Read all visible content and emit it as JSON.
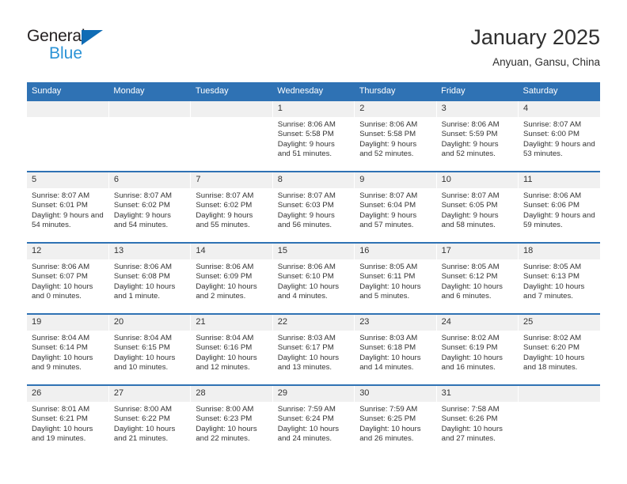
{
  "brand": {
    "name_part1": "General",
    "name_part2": "Blue",
    "triangle_icon": "blue-triangle-icon",
    "accent_color": "#0f6cb5",
    "secondary_color": "#2b93d6"
  },
  "header": {
    "title": "January 2025",
    "subtitle": "Anyuan, Gansu, China"
  },
  "calendar": {
    "header_bg": "#2f72b4",
    "daynum_bg": "#f0f0f0",
    "weekday_headers": [
      "Sunday",
      "Monday",
      "Tuesday",
      "Wednesday",
      "Thursday",
      "Friday",
      "Saturday"
    ],
    "weeks": [
      [
        {
          "day": "",
          "sunrise": "",
          "sunset": "",
          "daylight": "",
          "empty": true
        },
        {
          "day": "",
          "sunrise": "",
          "sunset": "",
          "daylight": "",
          "empty": true
        },
        {
          "day": "",
          "sunrise": "",
          "sunset": "",
          "daylight": "",
          "empty": true
        },
        {
          "day": "1",
          "sunrise": "Sunrise: 8:06 AM",
          "sunset": "Sunset: 5:58 PM",
          "daylight": "Daylight: 9 hours and 51 minutes."
        },
        {
          "day": "2",
          "sunrise": "Sunrise: 8:06 AM",
          "sunset": "Sunset: 5:58 PM",
          "daylight": "Daylight: 9 hours and 52 minutes."
        },
        {
          "day": "3",
          "sunrise": "Sunrise: 8:06 AM",
          "sunset": "Sunset: 5:59 PM",
          "daylight": "Daylight: 9 hours and 52 minutes."
        },
        {
          "day": "4",
          "sunrise": "Sunrise: 8:07 AM",
          "sunset": "Sunset: 6:00 PM",
          "daylight": "Daylight: 9 hours and 53 minutes."
        }
      ],
      [
        {
          "day": "5",
          "sunrise": "Sunrise: 8:07 AM",
          "sunset": "Sunset: 6:01 PM",
          "daylight": "Daylight: 9 hours and 54 minutes."
        },
        {
          "day": "6",
          "sunrise": "Sunrise: 8:07 AM",
          "sunset": "Sunset: 6:02 PM",
          "daylight": "Daylight: 9 hours and 54 minutes."
        },
        {
          "day": "7",
          "sunrise": "Sunrise: 8:07 AM",
          "sunset": "Sunset: 6:02 PM",
          "daylight": "Daylight: 9 hours and 55 minutes."
        },
        {
          "day": "8",
          "sunrise": "Sunrise: 8:07 AM",
          "sunset": "Sunset: 6:03 PM",
          "daylight": "Daylight: 9 hours and 56 minutes."
        },
        {
          "day": "9",
          "sunrise": "Sunrise: 8:07 AM",
          "sunset": "Sunset: 6:04 PM",
          "daylight": "Daylight: 9 hours and 57 minutes."
        },
        {
          "day": "10",
          "sunrise": "Sunrise: 8:07 AM",
          "sunset": "Sunset: 6:05 PM",
          "daylight": "Daylight: 9 hours and 58 minutes."
        },
        {
          "day": "11",
          "sunrise": "Sunrise: 8:06 AM",
          "sunset": "Sunset: 6:06 PM",
          "daylight": "Daylight: 9 hours and 59 minutes."
        }
      ],
      [
        {
          "day": "12",
          "sunrise": "Sunrise: 8:06 AM",
          "sunset": "Sunset: 6:07 PM",
          "daylight": "Daylight: 10 hours and 0 minutes."
        },
        {
          "day": "13",
          "sunrise": "Sunrise: 8:06 AM",
          "sunset": "Sunset: 6:08 PM",
          "daylight": "Daylight: 10 hours and 1 minute."
        },
        {
          "day": "14",
          "sunrise": "Sunrise: 8:06 AM",
          "sunset": "Sunset: 6:09 PM",
          "daylight": "Daylight: 10 hours and 2 minutes."
        },
        {
          "day": "15",
          "sunrise": "Sunrise: 8:06 AM",
          "sunset": "Sunset: 6:10 PM",
          "daylight": "Daylight: 10 hours and 4 minutes."
        },
        {
          "day": "16",
          "sunrise": "Sunrise: 8:05 AM",
          "sunset": "Sunset: 6:11 PM",
          "daylight": "Daylight: 10 hours and 5 minutes."
        },
        {
          "day": "17",
          "sunrise": "Sunrise: 8:05 AM",
          "sunset": "Sunset: 6:12 PM",
          "daylight": "Daylight: 10 hours and 6 minutes."
        },
        {
          "day": "18",
          "sunrise": "Sunrise: 8:05 AM",
          "sunset": "Sunset: 6:13 PM",
          "daylight": "Daylight: 10 hours and 7 minutes."
        }
      ],
      [
        {
          "day": "19",
          "sunrise": "Sunrise: 8:04 AM",
          "sunset": "Sunset: 6:14 PM",
          "daylight": "Daylight: 10 hours and 9 minutes."
        },
        {
          "day": "20",
          "sunrise": "Sunrise: 8:04 AM",
          "sunset": "Sunset: 6:15 PM",
          "daylight": "Daylight: 10 hours and 10 minutes."
        },
        {
          "day": "21",
          "sunrise": "Sunrise: 8:04 AM",
          "sunset": "Sunset: 6:16 PM",
          "daylight": "Daylight: 10 hours and 12 minutes."
        },
        {
          "day": "22",
          "sunrise": "Sunrise: 8:03 AM",
          "sunset": "Sunset: 6:17 PM",
          "daylight": "Daylight: 10 hours and 13 minutes."
        },
        {
          "day": "23",
          "sunrise": "Sunrise: 8:03 AM",
          "sunset": "Sunset: 6:18 PM",
          "daylight": "Daylight: 10 hours and 14 minutes."
        },
        {
          "day": "24",
          "sunrise": "Sunrise: 8:02 AM",
          "sunset": "Sunset: 6:19 PM",
          "daylight": "Daylight: 10 hours and 16 minutes."
        },
        {
          "day": "25",
          "sunrise": "Sunrise: 8:02 AM",
          "sunset": "Sunset: 6:20 PM",
          "daylight": "Daylight: 10 hours and 18 minutes."
        }
      ],
      [
        {
          "day": "26",
          "sunrise": "Sunrise: 8:01 AM",
          "sunset": "Sunset: 6:21 PM",
          "daylight": "Daylight: 10 hours and 19 minutes."
        },
        {
          "day": "27",
          "sunrise": "Sunrise: 8:00 AM",
          "sunset": "Sunset: 6:22 PM",
          "daylight": "Daylight: 10 hours and 21 minutes."
        },
        {
          "day": "28",
          "sunrise": "Sunrise: 8:00 AM",
          "sunset": "Sunset: 6:23 PM",
          "daylight": "Daylight: 10 hours and 22 minutes."
        },
        {
          "day": "29",
          "sunrise": "Sunrise: 7:59 AM",
          "sunset": "Sunset: 6:24 PM",
          "daylight": "Daylight: 10 hours and 24 minutes."
        },
        {
          "day": "30",
          "sunrise": "Sunrise: 7:59 AM",
          "sunset": "Sunset: 6:25 PM",
          "daylight": "Daylight: 10 hours and 26 minutes."
        },
        {
          "day": "31",
          "sunrise": "Sunrise: 7:58 AM",
          "sunset": "Sunset: 6:26 PM",
          "daylight": "Daylight: 10 hours and 27 minutes."
        },
        {
          "day": "",
          "sunrise": "",
          "sunset": "",
          "daylight": "",
          "empty": true
        }
      ]
    ]
  }
}
